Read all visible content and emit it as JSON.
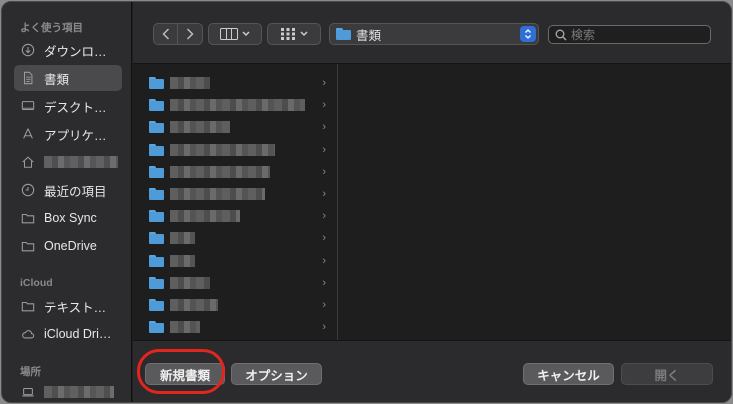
{
  "sidebar": {
    "sections": {
      "favorites": "よく使う項目",
      "icloud": "iCloud",
      "locations": "場所"
    },
    "items": [
      {
        "label": "ダウンロ…",
        "icon": "download-circle-icon"
      },
      {
        "label": "書類",
        "icon": "document-icon",
        "selected": true
      },
      {
        "label": "デスクト…",
        "icon": "desktop-icon"
      },
      {
        "label": "アプリケ…",
        "icon": "applications-icon"
      },
      {
        "label": "",
        "icon": "home-icon",
        "redacted": true
      },
      {
        "label": "最近の項目",
        "icon": "clock-icon"
      },
      {
        "label": "Box Sync",
        "icon": "folder-icon"
      },
      {
        "label": "OneDrive",
        "icon": "folder-icon"
      },
      {
        "label": "テキスト…",
        "icon": "folder-icon"
      },
      {
        "label": "iCloud Dri…",
        "icon": "cloud-icon"
      },
      {
        "label": "",
        "icon": "laptop-icon",
        "redacted": true
      }
    ]
  },
  "toolbar": {
    "location": "書類",
    "search_placeholder": "検索"
  },
  "browser": {
    "rows": 12
  },
  "buttons": {
    "new_document": "新規書類",
    "options": "オプション",
    "cancel": "キャンセル",
    "open": "開く"
  },
  "colors": {
    "accent": "#2f6fd8",
    "folder": "#4e9bd8",
    "highlight": "#e3261d"
  }
}
